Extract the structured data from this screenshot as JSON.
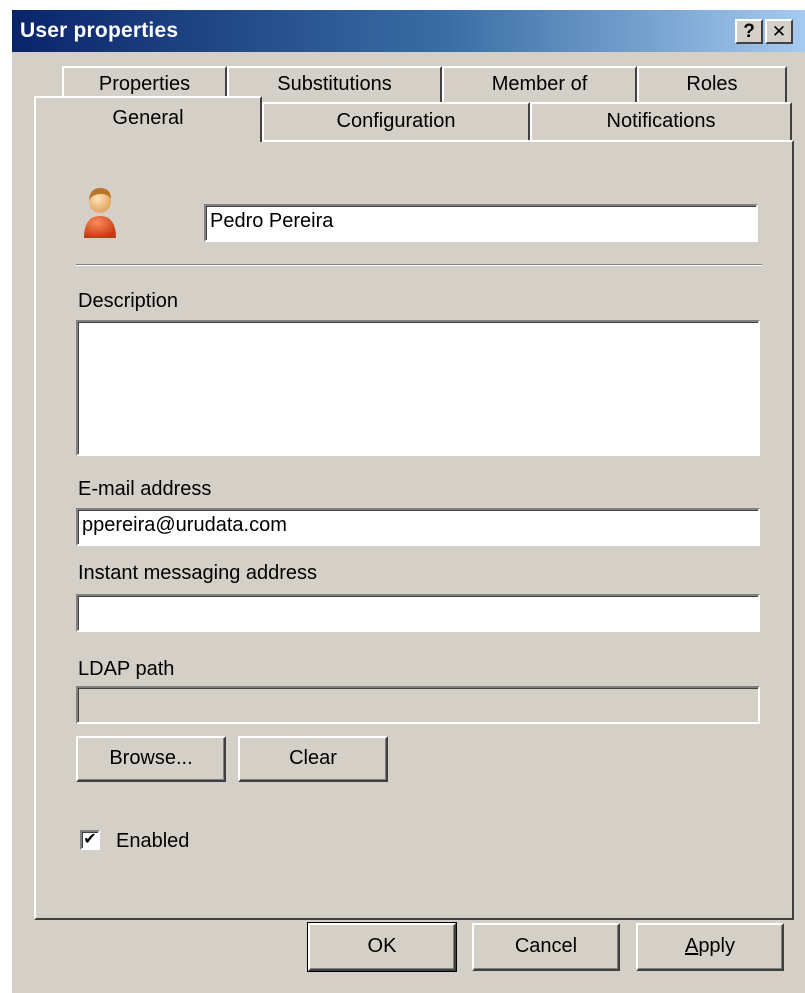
{
  "window": {
    "title": "User properties",
    "help_label": "?",
    "close_label": "✕"
  },
  "tabs": {
    "back_row": [
      "Properties",
      "Substitutions",
      "Member of",
      "Roles"
    ],
    "front_row": [
      "General",
      "Configuration",
      "Notifications"
    ],
    "active": "General"
  },
  "general": {
    "user_icon": "user-avatar-icon",
    "name_value": "Pedro Pereira",
    "description_label": "Description",
    "description_value": "",
    "email_label": "E-mail address",
    "email_value": "ppereira@urudata.com",
    "im_label": "Instant messaging address",
    "im_value": "",
    "ldap_label": "LDAP path",
    "ldap_value": "",
    "browse_label": "Browse...",
    "clear_label": "Clear",
    "enabled_label": "Enabled",
    "enabled_checked": true,
    "check_glyph": "✔"
  },
  "footer": {
    "ok_label": "OK",
    "cancel_label": "Cancel",
    "apply_label_accel": "A",
    "apply_label_rest": "pply"
  }
}
